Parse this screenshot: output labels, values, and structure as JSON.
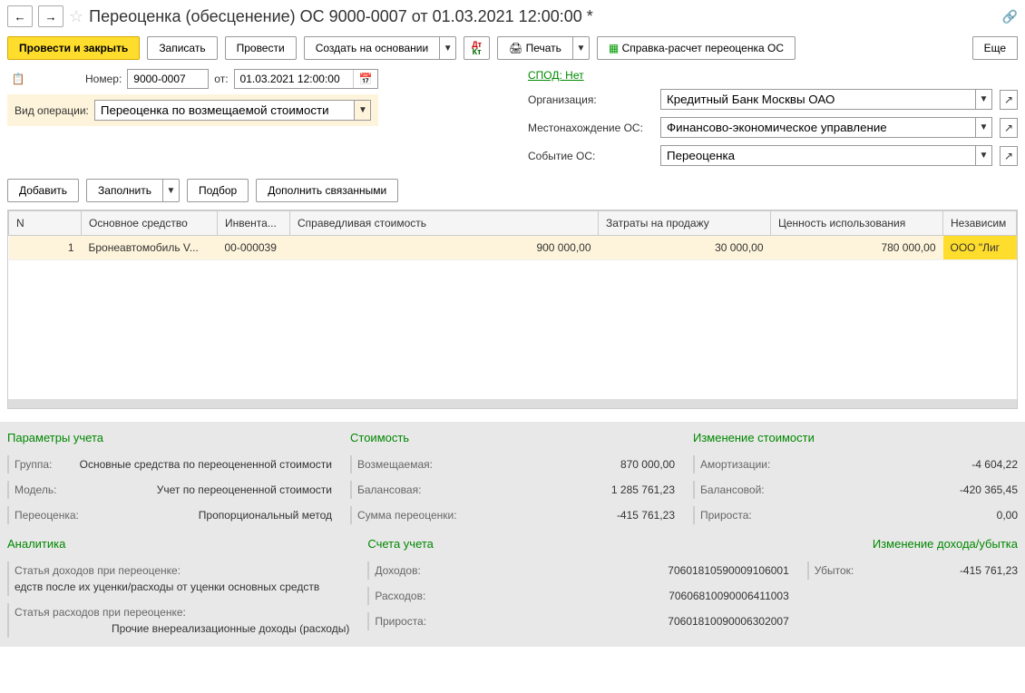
{
  "title": "Переоценка (обесценение) ОС 9000-0007 от 01.03.2021 12:00:00 *",
  "toolbar": {
    "postClose": "Провести и закрыть",
    "save": "Записать",
    "post": "Провести",
    "createBase": "Создать на основании",
    "print": "Печать",
    "docIcon": "📄",
    "report": "Справка-расчет переоценка ОС",
    "more": "Еще"
  },
  "form": {
    "numberLabel": "Номер:",
    "number": "9000-0007",
    "fromLabel": "от:",
    "date": "01.03.2021 12:00:00",
    "spod": "СПОД: Нет",
    "opTypeLabel": "Вид операции:",
    "opType": "Переоценка по возмещаемой стоимости",
    "orgLabel": "Организация:",
    "org": "Кредитный Банк Москвы ОАО",
    "locationLabel": "Местонахождение ОС:",
    "location": "Финансово-экономическое управление",
    "eventLabel": "Событие ОС:",
    "event": "Переоценка"
  },
  "tableBtns": {
    "add": "Добавить",
    "fill": "Заполнить",
    "pick": "Подбор",
    "extend": "Дополнить связанными"
  },
  "columns": {
    "n": "N",
    "asset": "Основное средство",
    "inv": "Инвента...",
    "fair": "Справедливая стоимость",
    "saleCost": "Затраты на продажу",
    "useValue": "Ценность использования",
    "indep": "Независим"
  },
  "row": {
    "n": "1",
    "asset": "Бронеавтомобиль V...",
    "inv": "00-000039",
    "fair": "900 000,00",
    "saleCost": "30 000,00",
    "useValue": "780 000,00",
    "indep": "ООО \"Лиг"
  },
  "details": {
    "params": {
      "title": "Параметры учета",
      "groupLabel": "Группа:",
      "group": "Основные средства по переоцененной стоимости",
      "modelLabel": "Модель:",
      "model": "Учет по переоцененной стоимости",
      "revalLabel": "Переоценка:",
      "reval": "Пропорциональный метод"
    },
    "cost": {
      "title": "Стоимость",
      "recovLabel": "Возмещаемая:",
      "recov": "870 000,00",
      "balLabel": "Балансовая:",
      "bal": "1 285 761,23",
      "revalLabel": "Сумма переоценки:",
      "reval": "-415 761,23"
    },
    "delta": {
      "title": "Изменение стоимости",
      "amortLabel": "Амортизации:",
      "amort": "-4 604,22",
      "balLabel": "Балансовой:",
      "bal": "-420 365,45",
      "growLabel": "Прироста:",
      "grow": "0,00"
    },
    "analytics": {
      "title": "Аналитика",
      "incomeLabel": "Статья доходов при переоценке:",
      "income": "едств после их уценки/расходы от уценки основных средств",
      "expenseLabel": "Статья расходов при переоценке:",
      "expense": "Прочие внереализационные доходы (расходы)"
    },
    "accounts": {
      "title": "Счета учета",
      "incLabel": "Доходов:",
      "inc": "70601810590009106001",
      "expLabel": "Расходов:",
      "exp": "70606810090006411003",
      "growLabel": "Прироста:",
      "grow": "70601810090006302007"
    },
    "profit": {
      "title": "Изменение дохода/убытка",
      "lossLabel": "Убыток:",
      "loss": "-415 761,23"
    }
  }
}
